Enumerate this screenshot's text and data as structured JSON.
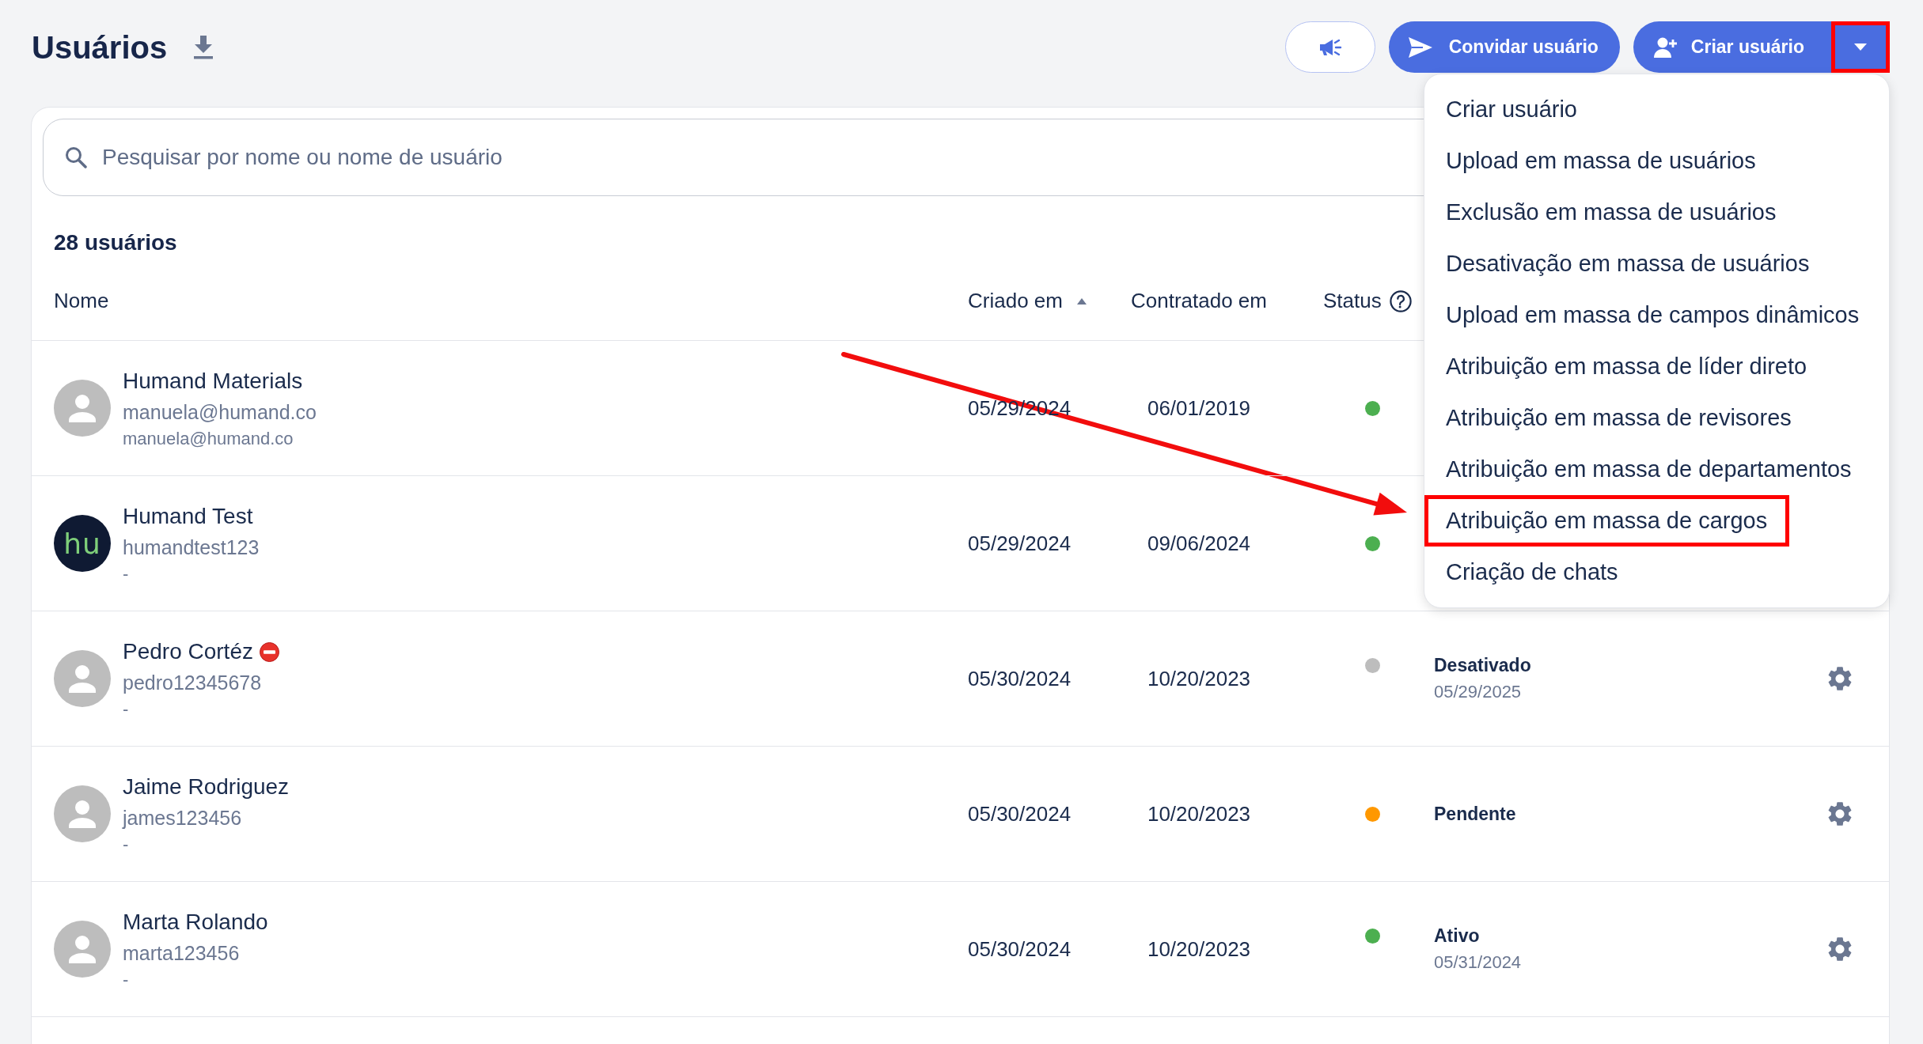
{
  "header": {
    "title": "Usuários",
    "actions": [
      {
        "kind": "icon"
      },
      {
        "kind": "invite",
        "label": "Convidar usuário"
      },
      {
        "kind": "split",
        "label": "Criar usuário",
        "expanded": true,
        "marked": true,
        "menu": [
          {
            "label": "Criar usuário",
            "marked": false
          },
          {
            "label": "Upload em massa de usuários",
            "marked": false
          },
          {
            "label": "Exclusão em massa de usuários",
            "marked": false
          },
          {
            "label": "Desativação em massa de usuários",
            "marked": false
          },
          {
            "label": "Upload em massa de campos dinâmicos",
            "marked": false
          },
          {
            "label": "Atribuição em massa de líder direto",
            "marked": false
          },
          {
            "label": "Atribuição em massa de revisores",
            "marked": false
          },
          {
            "label": "Atribuição em massa de departamentos",
            "marked": false
          },
          {
            "label": "Atribuição em massa de cargos",
            "marked": true
          },
          {
            "label": "Criação de chats",
            "marked": false
          }
        ]
      }
    ]
  },
  "search": {
    "placeholder": "Pesquisar por nome ou nome de usuário"
  },
  "count": "28 usuários",
  "table": {
    "columns": [
      {
        "label": "Nome",
        "sorted": false,
        "help": false
      },
      {
        "label": "Criado em",
        "sorted": true,
        "help": false
      },
      {
        "label": "Contratado em",
        "sorted": false,
        "help": false
      },
      {
        "label": "Status",
        "sorted": false,
        "help": true
      }
    ],
    "rows": [
      {
        "name": "Humand Materials",
        "blocked": false,
        "avatar": {
          "kind": "placeholder"
        },
        "username": "manuela@humand.co",
        "detail": "manuela@humand.co",
        "created": "05/29/2024",
        "hired": "06/01/2019",
        "status": {
          "color": "#4caf50"
        },
        "settings": false
      },
      {
        "name": "Humand Test",
        "blocked": false,
        "avatar": {
          "kind": "logo",
          "text": "hu"
        },
        "username": "humandtest123",
        "detail": "-",
        "created": "05/29/2024",
        "hired": "09/06/2024",
        "status": {
          "color": "#4caf50"
        },
        "settings": false
      },
      {
        "name": "Pedro Cortéz",
        "blocked": true,
        "avatar": {
          "kind": "placeholder"
        },
        "username": "pedro12345678",
        "detail": "-",
        "created": "05/30/2024",
        "hired": "10/20/2023",
        "status": {
          "label": "Desativado",
          "date": "05/29/2025",
          "color": "#bdbdbd"
        },
        "settings": true
      },
      {
        "name": "Jaime Rodriguez",
        "blocked": false,
        "avatar": {
          "kind": "placeholder"
        },
        "username": "james123456",
        "detail": "-",
        "created": "05/30/2024",
        "hired": "10/20/2023",
        "status": {
          "label": "Pendente",
          "color": "#ff9800"
        },
        "settings": true
      },
      {
        "name": "Marta Rolando",
        "blocked": false,
        "avatar": {
          "kind": "placeholder"
        },
        "username": "marta123456",
        "detail": "-",
        "created": "05/30/2024",
        "hired": "10/20/2023",
        "status": {
          "label": "Ativo",
          "date": "05/31/2024",
          "color": "#4caf50"
        },
        "settings": true
      }
    ]
  }
}
